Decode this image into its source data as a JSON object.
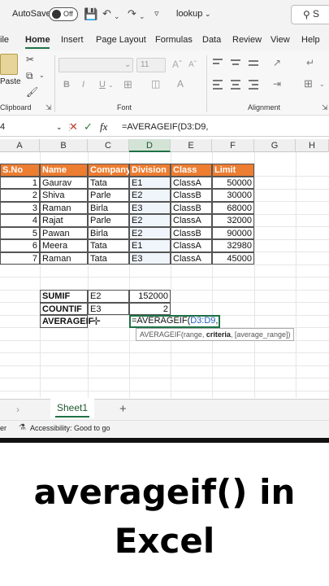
{
  "titlebar": {
    "autosave_label": "AutoSave",
    "autosave_state": "Off",
    "file_name": "lookup",
    "search_placeholder": "S"
  },
  "menu": {
    "items": [
      "ile",
      "Home",
      "Insert",
      "Page Layout",
      "Formulas",
      "Data",
      "Review",
      "View",
      "Help"
    ],
    "active": "Home"
  },
  "ribbon": {
    "paste_label": "Paste",
    "clipboard_label": "Clipboard",
    "font_label": "Font",
    "alignment_label": "Alignment",
    "font_size": "11",
    "bold": "B",
    "italic": "I",
    "underline": "U"
  },
  "formula_bar": {
    "name_box": "4",
    "formula": "=AVERAGEIF(D3:D9,"
  },
  "columns": [
    "A",
    "B",
    "C",
    "D",
    "E",
    "F",
    "G",
    "H"
  ],
  "selected_column": "D",
  "table": {
    "headers": [
      "S.No",
      "Name",
      "Company",
      "Division",
      "Class",
      "Limit"
    ],
    "rows": [
      [
        "1",
        "Gaurav",
        "Tata",
        "E1",
        "ClassA",
        "50000"
      ],
      [
        "2",
        "Shiva",
        "Parle",
        "E2",
        "ClassB",
        "30000"
      ],
      [
        "3",
        "Raman",
        "Birla",
        "E3",
        "ClassB",
        "68000"
      ],
      [
        "4",
        "Rajat",
        "Parle",
        "E2",
        "ClassA",
        "32000"
      ],
      [
        "5",
        "Pawan",
        "Birla",
        "E2",
        "ClassB",
        "90000"
      ],
      [
        "6",
        "Meera",
        "Tata",
        "E1",
        "ClassA",
        "32980"
      ],
      [
        "7",
        "Raman",
        "Tata",
        "E3",
        "ClassA",
        "45000"
      ]
    ]
  },
  "summary": {
    "sumif_label": "SUMIF",
    "sumif_criteria": "E2",
    "sumif_value": "152000",
    "countif_label": "COUNTIF",
    "countif_criteria": "E3",
    "countif_value": "2",
    "averageif_label": "AVERAGEIF",
    "averageif_editing": "=AVERAGEIF(D3:D9,"
  },
  "tooltip": {
    "prefix": "AVERAGEIF(range, ",
    "bold_arg": "criteria",
    "suffix": ", [average_range])"
  },
  "sheets": {
    "active": "Sheet1",
    "add_label": "+"
  },
  "status": {
    "left": "er",
    "accessibility": "Accessibility: Good to go"
  },
  "caption": {
    "line1": "averageif() in",
    "line2": "Excel"
  },
  "colors": {
    "header_fill": "#ed7d31",
    "excel_green": "#1e7145",
    "range_blue": "#3b7bd6"
  }
}
